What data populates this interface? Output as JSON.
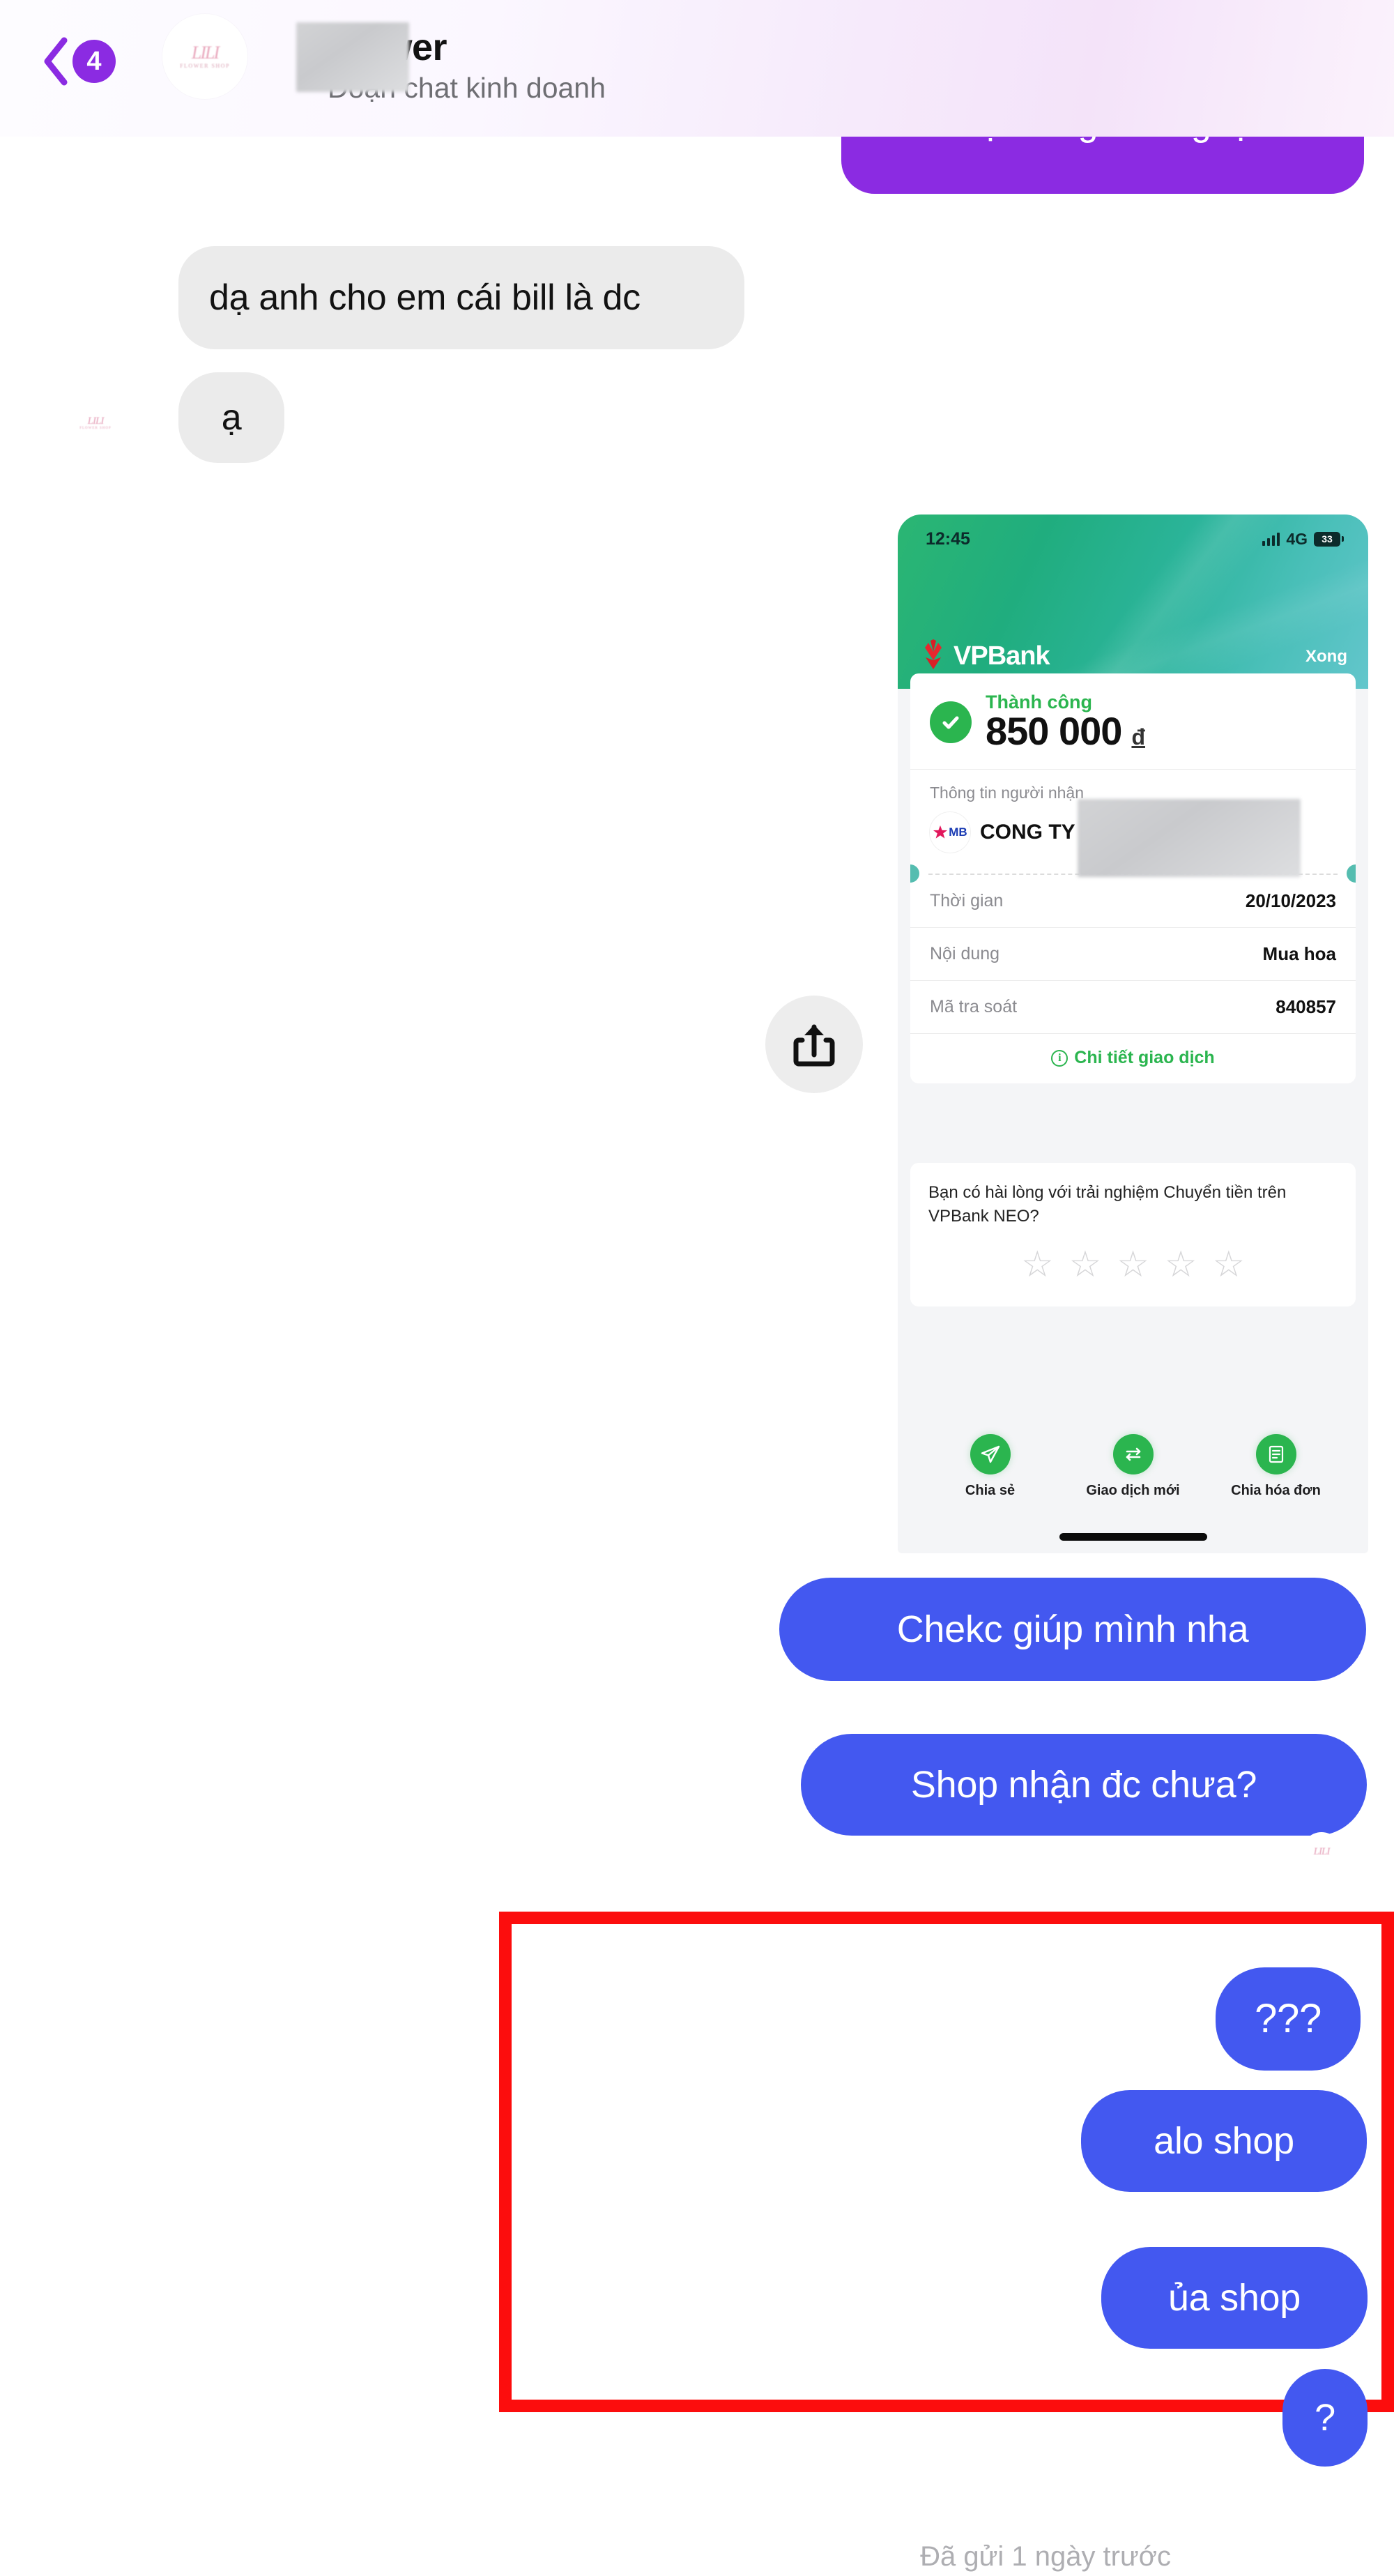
{
  "header": {
    "back_icon": "chevron-left-icon",
    "unread_count": "4",
    "avatar_logo": "LILI",
    "avatar_logo_sub": "FLOWER SHOP",
    "title": "Flower",
    "subtitle": "Đoạn chat kinh doanh",
    "redaction_note": "blurred-name-block"
  },
  "conversation": {
    "messages": [
      {
        "id": "m1",
        "side": "outgoing",
        "style": "purple",
        "text": "Nội dung ck là gì ạ",
        "clipped": true
      },
      {
        "id": "m2",
        "side": "incoming",
        "style": "gray",
        "text": "dạ anh cho em cái bill là dc"
      },
      {
        "id": "m3",
        "side": "incoming",
        "style": "gray",
        "text": "ạ"
      },
      {
        "id": "m4",
        "side": "outgoing",
        "style": "attachment",
        "text": "VPBank transfer receipt screenshot"
      },
      {
        "id": "m5",
        "side": "outgoing",
        "style": "blue",
        "text": "Chekc giúp mình nha"
      },
      {
        "id": "m6",
        "side": "outgoing",
        "style": "blue",
        "text": "Shop nhận đc chưa?"
      },
      {
        "id": "m7",
        "side": "outgoing",
        "style": "blue",
        "text": "???"
      },
      {
        "id": "m8",
        "side": "outgoing",
        "style": "blue",
        "text": "alo shop"
      },
      {
        "id": "m9",
        "side": "outgoing",
        "style": "blue",
        "text": "ủa shop"
      },
      {
        "id": "m10",
        "side": "outgoing",
        "style": "blue",
        "text": "?"
      }
    ],
    "sent_status": "Đã gửi 1 ngày trước",
    "share_icon": "share-up-box-icon"
  },
  "receipt": {
    "status_bar": {
      "time": "12:45",
      "signal_icon": "signal-bars-icon",
      "network": "4G",
      "battery_level": "33"
    },
    "brand": {
      "logo_icon": "vpbank-flower-logo-icon",
      "name": "VPBank",
      "done_label": "Xong"
    },
    "result": {
      "check_icon": "check-circle-icon",
      "status": "Thành công",
      "amount": "850 000",
      "currency": "đ"
    },
    "recipient": {
      "label": "Thông tin người nhận",
      "bank_icon": "mb-bank-logo-icon",
      "bank_short": "MB",
      "name": "CONG TY",
      "redaction_note": "blurred-recipient-details"
    },
    "details": [
      {
        "label": "Thời gian",
        "value": "20/10/2023"
      },
      {
        "label": "Nội dung",
        "value": "Mua hoa"
      },
      {
        "label": "Mã tra soát",
        "value": "840857"
      }
    ],
    "detail_link": {
      "icon": "info-circle-icon",
      "label": "Chi tiết giao dịch"
    },
    "survey": {
      "question": "Bạn có hài lòng với trải nghiệm Chuyển tiền trên VPBank NEO?",
      "stars": [
        "☆",
        "☆",
        "☆",
        "☆",
        "☆"
      ],
      "rating_selected": "0"
    },
    "actions": [
      {
        "icon": "paper-plane-icon",
        "label": "Chia sẻ"
      },
      {
        "icon": "swap-arrows-icon",
        "label": "Giao dịch mới"
      },
      {
        "icon": "receipt-icon",
        "label": "Chia hóa đơn"
      }
    ]
  },
  "annotation": {
    "box_color": "#fc0d0d",
    "note": "highlight-box-around-unanswered-messages"
  },
  "colors": {
    "accent_purple": "#8b2be2",
    "bubble_blue": "#4358f0",
    "bubble_gray": "#ebebeb",
    "bank_green": "#2bb54f",
    "annotation_red": "#fc0d0d"
  }
}
